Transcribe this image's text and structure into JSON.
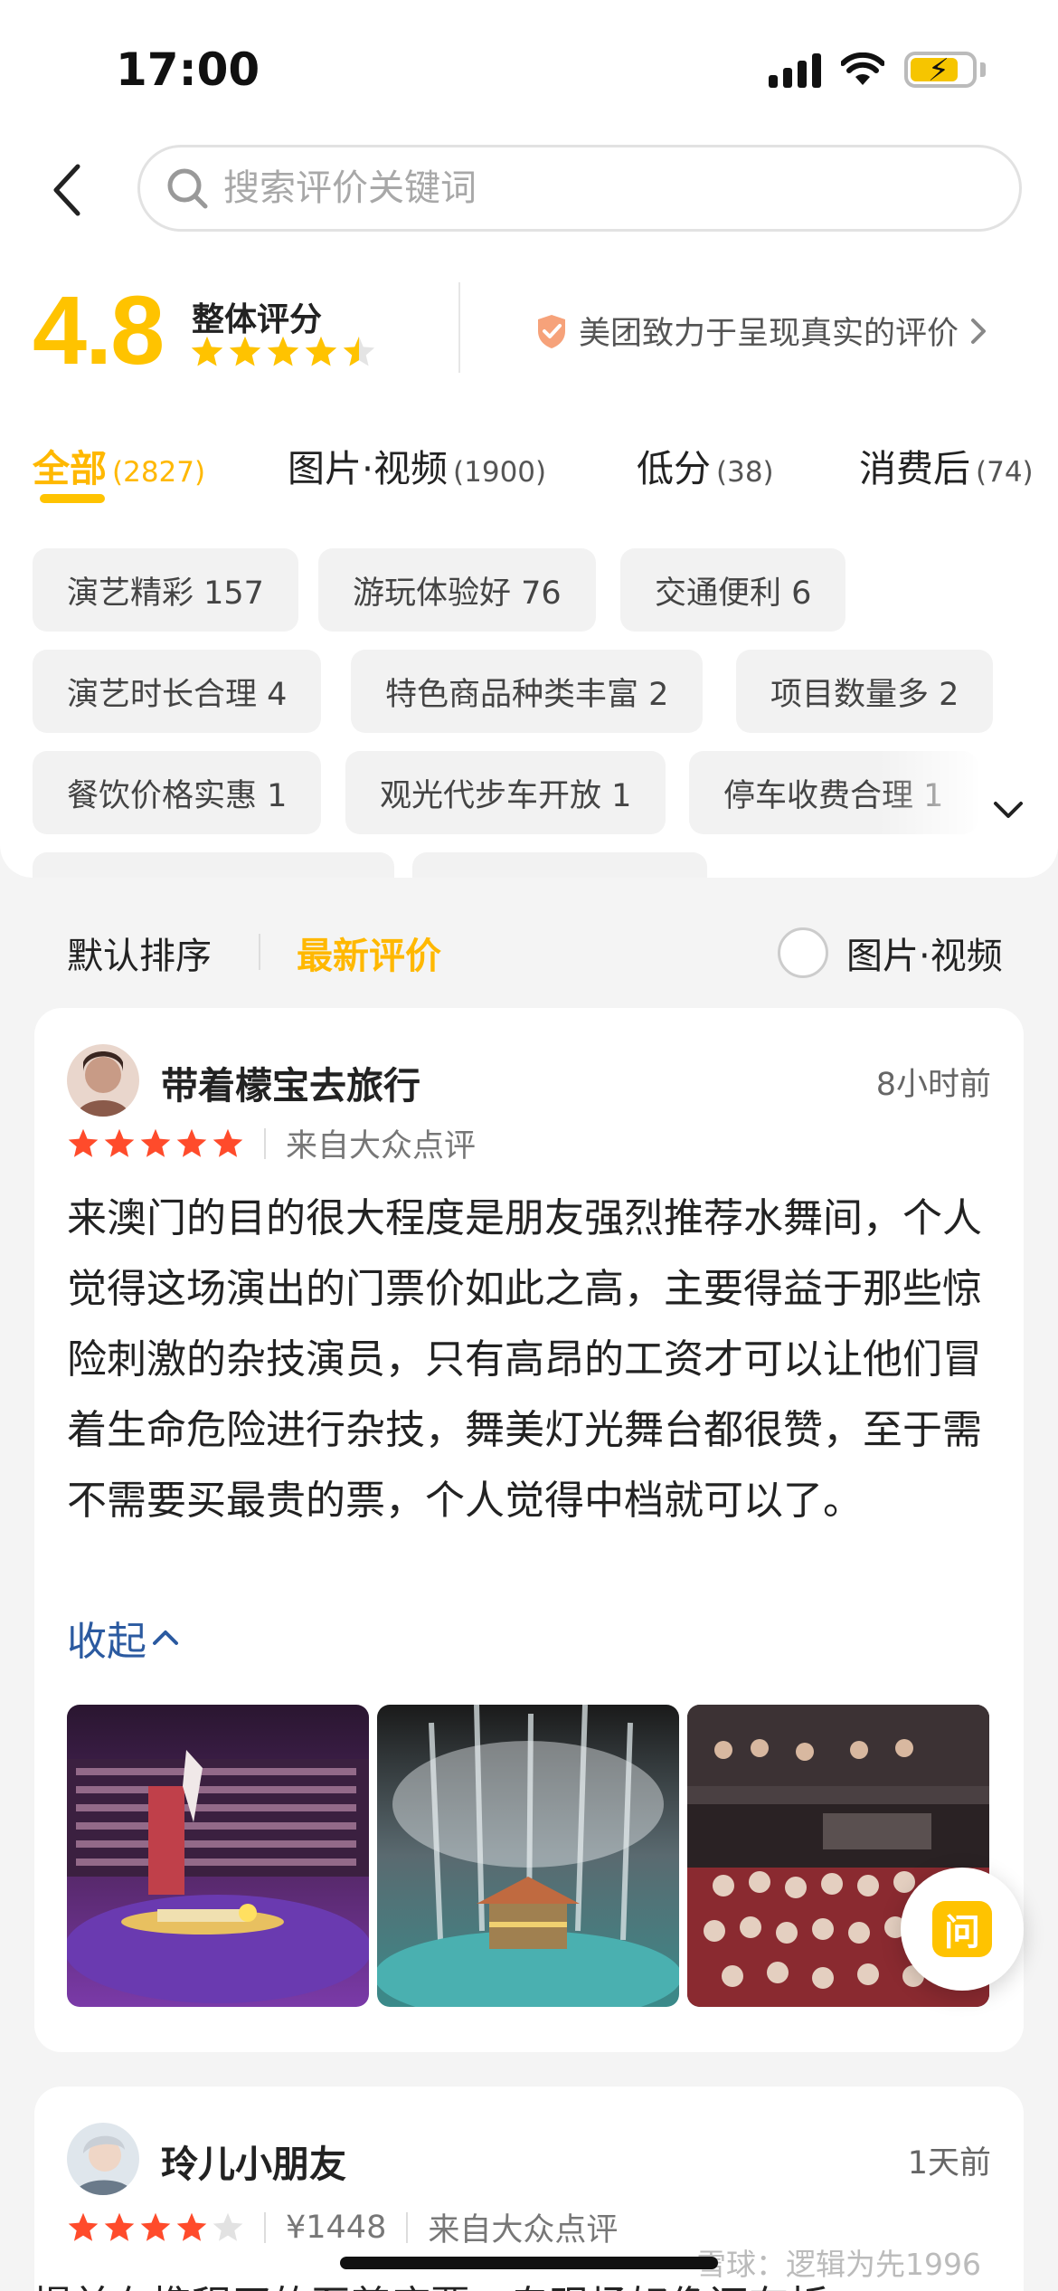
{
  "status_bar": {
    "time": "17:00"
  },
  "search": {
    "placeholder": "搜索评价关键词"
  },
  "rating": {
    "score": "4.8",
    "label": "整体评分",
    "stars": 4.5,
    "trust_text": "美团致力于呈现真实的评价"
  },
  "tabs": [
    {
      "label": "全部",
      "count": "(2827)"
    },
    {
      "label": "图片·视频",
      "count": "(1900)"
    },
    {
      "label": "低分",
      "count": "(38)"
    },
    {
      "label": "消费后",
      "count": "(74)"
    }
  ],
  "tags": [
    "演艺精彩 157",
    "游玩体验好 76",
    "交通便利 6",
    "演艺时长合理 4",
    "特色商品种类丰富 2",
    "项目数量多 2",
    "餐饮价格实惠 1",
    "观光代步车开放 1",
    "停车收费合理 1"
  ],
  "sort": {
    "default": "默认排序",
    "newest": "最新评价",
    "media_filter": "图片·视频"
  },
  "reviews": [
    {
      "username": "带着檬宝去旅行",
      "time": "8小时前",
      "stars": 5,
      "source": "来自大众点评",
      "text": "来澳门的目的很大程度是朋友强烈推荐水舞间，个人觉得这场演出的门票价如此之高，主要得益于那些惊险刺激的杂技演员，只有高昂的工资才可以让他们冒着生命危险进行杂技，舞美灯光舞台都很赞，至于需不需要买最贵的票，个人觉得中档就可以了。",
      "collapse_label": "收起"
    },
    {
      "username": "玲儿小朋友",
      "time": "1天前",
      "stars": 4,
      "price": "¥1448",
      "source": "来自大众点评",
      "text_peek": "提前在携程买的至尊座票，专现场好像还有折"
    }
  ],
  "ask_button": {
    "label": "问"
  },
  "watermark": {
    "text": "雪球：逻辑为先1996"
  },
  "colors": {
    "accent": "#ffc300",
    "star_red": "#ff4b2b",
    "link": "#2b5aa0"
  }
}
